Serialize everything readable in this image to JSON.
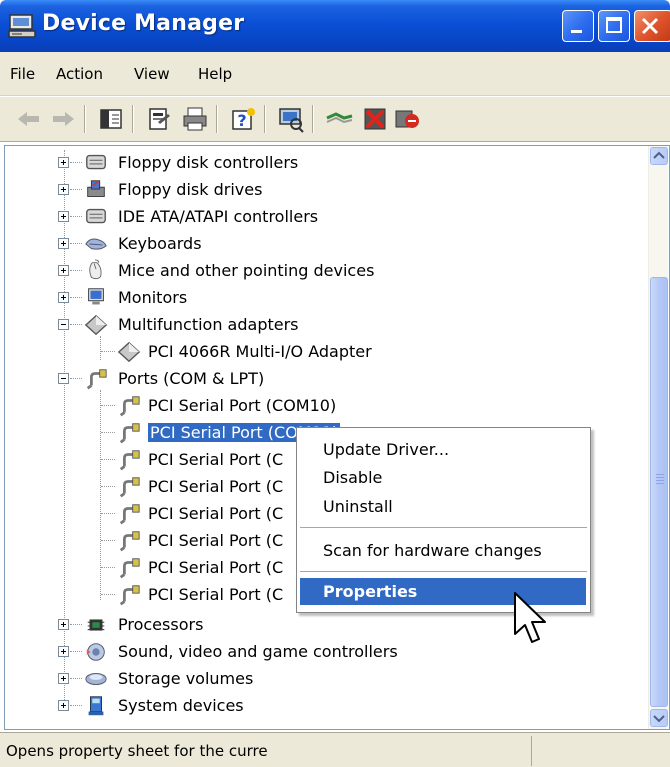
{
  "window": {
    "title": "Device Manager"
  },
  "menu": [
    "File",
    "Action",
    "View",
    "Help"
  ],
  "toolbar": {
    "icons": [
      "back-arrow-icon",
      "forward-arrow-icon",
      "show-hide-console-tree-icon",
      "properties-icon",
      "print-icon",
      "help-icon",
      "scan-hardware-icon",
      "update-driver-icon",
      "uninstall-icon",
      "disable-icon"
    ]
  },
  "tree": {
    "items": [
      {
        "label": "Floppy disk controllers",
        "expanded": false
      },
      {
        "label": "Floppy disk drives",
        "expanded": false
      },
      {
        "label": "IDE ATA/ATAPI controllers",
        "expanded": false
      },
      {
        "label": "Keyboards",
        "expanded": false
      },
      {
        "label": "Mice and other pointing devices",
        "expanded": false
      },
      {
        "label": "Monitors",
        "expanded": false
      },
      {
        "label": "Multifunction adapters",
        "expanded": true
      },
      {
        "label": "PCI 4066R Multi-I/O Adapter"
      },
      {
        "label": "Ports (COM & LPT)",
        "expanded": true
      },
      {
        "label": "PCI Serial Port (COM10)"
      },
      {
        "label": "PCI Serial Port (COM11)",
        "selected": true
      },
      {
        "label": "PCI Serial Port (C"
      },
      {
        "label": "PCI Serial Port (C"
      },
      {
        "label": "PCI Serial Port (C"
      },
      {
        "label": "PCI Serial Port (C"
      },
      {
        "label": "PCI Serial Port (C"
      },
      {
        "label": "PCI Serial Port (C"
      },
      {
        "label": "Processors",
        "expanded": false
      },
      {
        "label": "Sound, video and game controllers",
        "expanded": false
      },
      {
        "label": "Storage volumes",
        "expanded": false
      },
      {
        "label": "System devices",
        "expanded": false
      }
    ]
  },
  "context_menu": {
    "update_driver": "Update Driver...",
    "disable": "Disable",
    "uninstall": "Uninstall",
    "scan": "Scan for hardware changes",
    "properties": "Properties"
  },
  "status": {
    "text": "Opens property sheet for the curre"
  },
  "colors": {
    "selection": "#316ac5",
    "titlebar": "#0a50d6",
    "chrome": "#ece9d8"
  }
}
